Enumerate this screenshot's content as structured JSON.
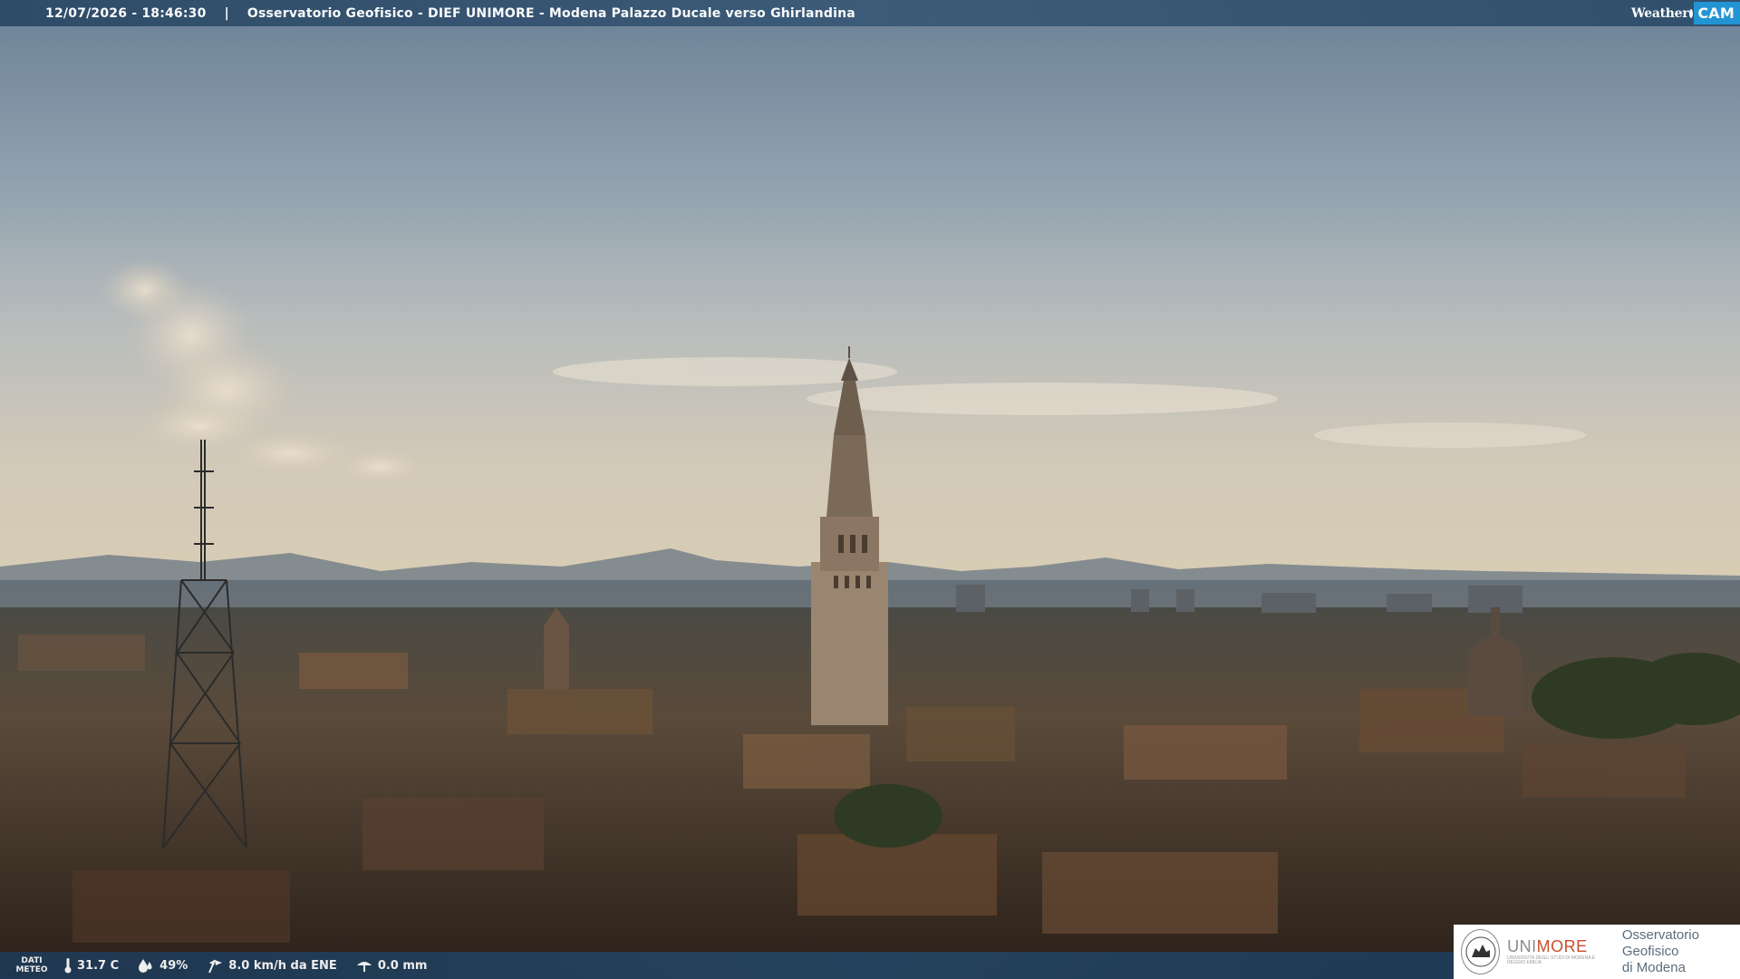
{
  "topbar": {
    "timestamp": "12/07/2026 - 18:46:30",
    "separator": "|",
    "title": "Osservatorio Geofisico - DIEF UNIMORE - Modena Palazzo Ducale verso Ghirlandina",
    "brand_weather": "Weather",
    "brand_cam": "CAM"
  },
  "weather": {
    "label_line1": "DATI",
    "label_line2": "METEO",
    "temperature": "31.7 C",
    "humidity": "49%",
    "wind": "8.0 km/h da ENE",
    "rain": "0.0 mm"
  },
  "logo": {
    "uni_prefix": "UNI",
    "uni_suffix": "MORE",
    "uni_sub": "UNIVERSITÀ DEGLI STUDI DI MODENA E REGGIO EMILIA",
    "observatory_line1": "Osservatorio Geofisico",
    "observatory_line2": "di Modena"
  },
  "colors": {
    "topbar": "#3a5a78",
    "bottombar": "#244563",
    "brand_cam_bg": "#1f95d6",
    "unimore_accent": "#c94d2a"
  },
  "icons": [
    "thermometer-icon",
    "humidity-icon",
    "wind-icon",
    "rain-gauge-icon",
    "university-seal-icon"
  ]
}
